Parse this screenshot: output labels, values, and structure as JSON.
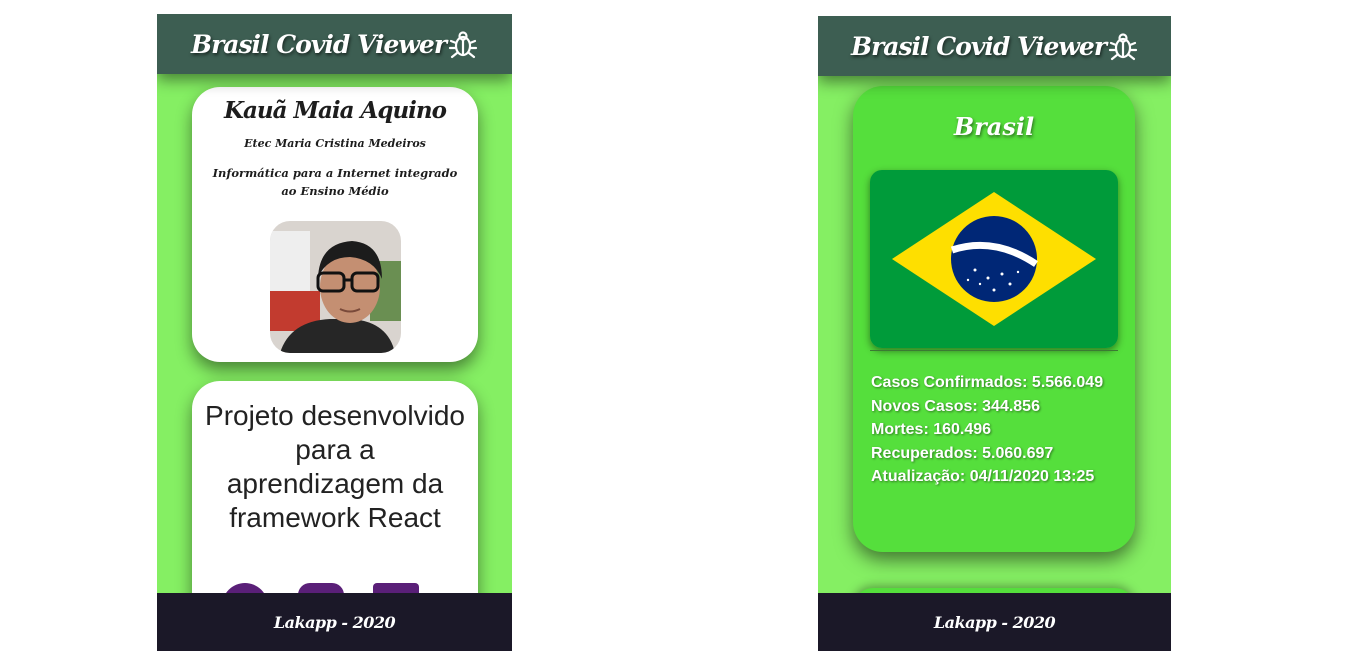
{
  "left_screen": {
    "header": {
      "title": "Brasil Covid Viewer"
    },
    "profile": {
      "name": "Kauã Maia Aquino",
      "school": "Etec Maria Cristina Medeiros",
      "course": "Informática para a Internet integrado ao Ensino Médio"
    },
    "project": {
      "description": "Projeto desenvolvido para a aprendizagem da framework React"
    },
    "footer": {
      "text": "Lakapp - 2020"
    }
  },
  "right_screen": {
    "header": {
      "title": "Brasil Covid Viewer"
    },
    "country": {
      "name": "Brasil",
      "stats": {
        "confirmed": "Casos Confirmados: 5.566.049",
        "new_cases": "Novos Casos: 344.856",
        "deaths": "Mortes: 160.496",
        "recovered": "Recuperados: 5.060.697",
        "updated": "Atualização: 04/11/2020 13:25"
      }
    },
    "footer": {
      "text": "Lakapp - 2020"
    }
  },
  "icons": [
    "bug-icon",
    "github-icon",
    "instagram-icon",
    "linkedin-icon"
  ],
  "colors": {
    "header_bg": "#3d5e52",
    "page_bg": "#85ef63",
    "card_green": "#55df3c",
    "footer_bg": "#1b1828",
    "social_purple": "#5a1f78"
  }
}
